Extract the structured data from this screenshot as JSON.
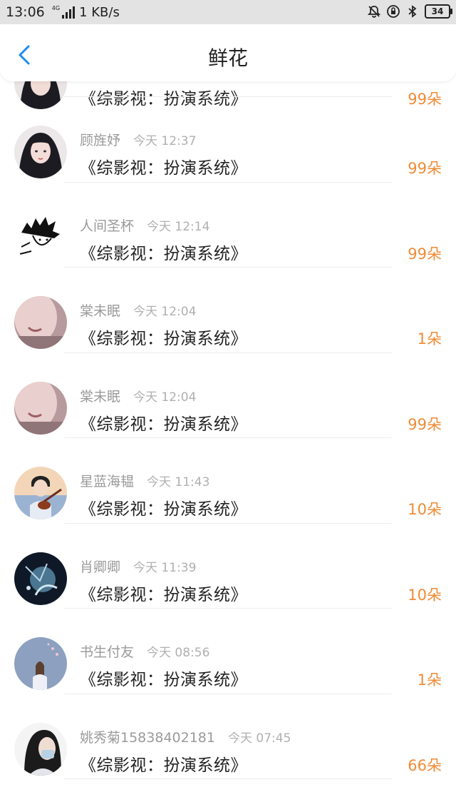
{
  "status_bar": {
    "time": "13:06",
    "network": "4G",
    "speed": "1 KB/s",
    "battery": "34",
    "icons": [
      "alarm-off-icon",
      "data-saver-icon",
      "bluetooth-icon"
    ]
  },
  "header": {
    "title": "鲜花",
    "back_icon": "chevron-left-icon"
  },
  "colors": {
    "accent": "#1a8cf0",
    "count": "#f08b35",
    "name": "#9a9a9a",
    "time": "#b0b0b0"
  },
  "list": [
    {
      "name": "",
      "time": "",
      "book": "《综影视：扮演系统》",
      "count": "99朵",
      "avatar": "girl-dark-hair"
    },
    {
      "name": "顾旌妤",
      "time": "今天 12:37",
      "book": "《综影视：扮演系统》",
      "count": "99朵",
      "avatar": "girl-dark-hair"
    },
    {
      "name": "人间圣杯",
      "time": "今天 12:14",
      "book": "《综影视：扮演系统》",
      "count": "99朵",
      "avatar": "sketch-boy"
    },
    {
      "name": "棠未眠",
      "time": "今天 12:04",
      "book": "《综影视：扮演系统》",
      "count": "1朵",
      "avatar": "pink-face"
    },
    {
      "name": "棠未眠",
      "time": "今天 12:04",
      "book": "《综影视：扮演系统》",
      "count": "99朵",
      "avatar": "pink-face"
    },
    {
      "name": "星蓝海韫",
      "time": "今天 11:43",
      "book": "《综影视：扮演系统》",
      "count": "10朵",
      "avatar": "violin-boy"
    },
    {
      "name": "肖卿卿",
      "time": "今天 11:39",
      "book": "《综影视：扮演系统》",
      "count": "10朵",
      "avatar": "night-art"
    },
    {
      "name": "书生付友",
      "time": "今天 08:56",
      "book": "《综影视：扮演系统》",
      "count": "1朵",
      "avatar": "girl-blossom"
    },
    {
      "name": "姚秀菊15838402181",
      "time": "今天 07:45",
      "book": "《综影视：扮演系统》",
      "count": "66朵",
      "avatar": "girl-mask"
    }
  ]
}
